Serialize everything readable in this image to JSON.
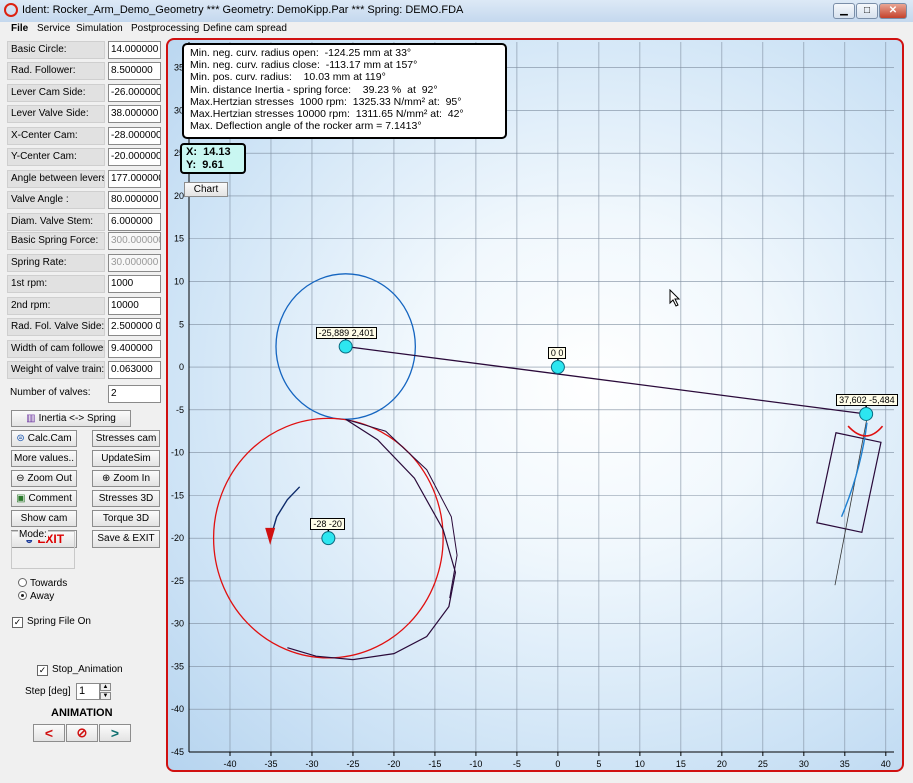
{
  "window": {
    "title": "Ident: Rocker_Arm_Demo_Geometry *** Geometry: DemoKipp.Par  ***  Spring: DEMO.FDA",
    "minimize_glyph": "▁",
    "maximize_glyph": "□",
    "close_glyph": "✕"
  },
  "menu": [
    "File",
    "Service",
    "Simulation",
    "Postprocessing",
    "Define cam spread"
  ],
  "parameters": [
    {
      "label": "Basic Circle:",
      "value": "14.000000"
    },
    {
      "label": "Rad. Follower:",
      "value": "8.500000"
    },
    {
      "label": "Lever Cam Side:",
      "value": "-26.000000"
    },
    {
      "label": "Lever Valve Side:",
      "value": "38.000000"
    },
    {
      "label": "X-Center Cam:",
      "value": "-28.000000"
    },
    {
      "label": "Y-Center Cam:",
      "value": "-20.000000"
    },
    {
      "label": "Angle between levers:",
      "value": "177.000000"
    },
    {
      "label": "Valve Angle :",
      "value": "80.000000"
    },
    {
      "label": "Diam. Valve Stem:",
      "value": "6.000000"
    },
    {
      "label": "Basic Spring Force:",
      "value": "300.000000",
      "disabled": true
    },
    {
      "label": "Spring Rate:",
      "value": "30.000000",
      "disabled": true
    },
    {
      "label": "1st  rpm:",
      "value": "1000"
    },
    {
      "label": "2nd rpm:",
      "value": "10000"
    },
    {
      "label": "Rad. Fol. Valve Side:",
      "value": "2.500000 0"
    },
    {
      "label": "Width of cam follower:",
      "value": "9.400000"
    },
    {
      "label": "Weight of valve train:",
      "value": "0.063000"
    },
    {
      "label": "Number of valves:",
      "value": "2"
    }
  ],
  "buttons": {
    "inertia_spring": "Inertia <-> Spring",
    "calc_cam": "Calc.Cam",
    "stresses_cam": "Stresses cam",
    "more_values": "More values..",
    "update_sim": "UpdateSim",
    "zoom_out": "Zoom Out",
    "zoom_in": "Zoom In",
    "comment": "Comment",
    "stresses_3d": "Stresses 3D",
    "show_cam": "Show cam",
    "torque_3d": "Torque 3D",
    "exit": "EXIT",
    "save_exit": "Save & EXIT"
  },
  "mode": {
    "legend": "Mode:",
    "options": [
      "Towards",
      "Away"
    ],
    "selected": "Away"
  },
  "spring_file": {
    "label": "Spring File On",
    "checked": true,
    "check_glyph": "✓"
  },
  "stop_animation": {
    "label": "Stop_Animation",
    "checked": true,
    "check_glyph": "✓"
  },
  "step": {
    "label": "Step [deg]",
    "value": "1",
    "up_glyph": "▲",
    "down_glyph": "▼"
  },
  "animation": {
    "title": "ANIMATION",
    "prev": "<",
    "stop": "⊘",
    "next": ">"
  },
  "info": [
    "Min. neg. curv. radius open:  -124.25 mm at 33°",
    "Min. neg. curv. radius close:  -113.17 mm at 157°",
    "Min. pos. curv. radius:    10.03 mm at 119°",
    "Min. distance Inertia - spring force:    39.23 %  at  92°",
    "Max.Hertzian stresses  1000 rpm:  1325.33 N/mm² at:  95°",
    "Max.Hertzian stresses 10000 rpm:  1311.65 N/mm² at:  42°",
    "Max. Deflection angle of the rocker arm = 7.1413°"
  ],
  "cursor": {
    "x_label": "X:  14.13",
    "y_label": "Y:  9.61"
  },
  "chart_button": "Chart",
  "chart_data": {
    "type": "scatter",
    "xlim": [
      -45,
      41
    ],
    "ylim": [
      -45,
      38
    ],
    "xticks": [
      -40,
      -35,
      -30,
      -25,
      -20,
      -15,
      -10,
      -5,
      0,
      5,
      10,
      15,
      20,
      25,
      30,
      35,
      40
    ],
    "yticks": [
      35,
      30,
      25,
      20,
      15,
      10,
      5,
      0,
      -5,
      -10,
      -15,
      -20,
      -25,
      -30,
      -35,
      -40,
      -45
    ],
    "grid": true,
    "points": [
      {
        "x": -25.889,
        "y": 2.401,
        "label": "-25,889 2,401"
      },
      {
        "x": 0,
        "y": 0,
        "label": "0 0"
      },
      {
        "x": 37.602,
        "y": -5.484,
        "label": "37,602 -5,484"
      },
      {
        "x": -28,
        "y": -20,
        "label": "-28 -20"
      }
    ],
    "circles": [
      {
        "cx": -25.889,
        "cy": 2.401,
        "r": 8.5,
        "color": "#1565c0"
      },
      {
        "cx": -28,
        "cy": -20,
        "r": 14,
        "color": "#e01010"
      }
    ],
    "cam_color": "#2a0a3a",
    "lever_color": "#2a0a3a",
    "arrow_color": "#0d2a6a",
    "arrowhead_color": "#d01010"
  }
}
